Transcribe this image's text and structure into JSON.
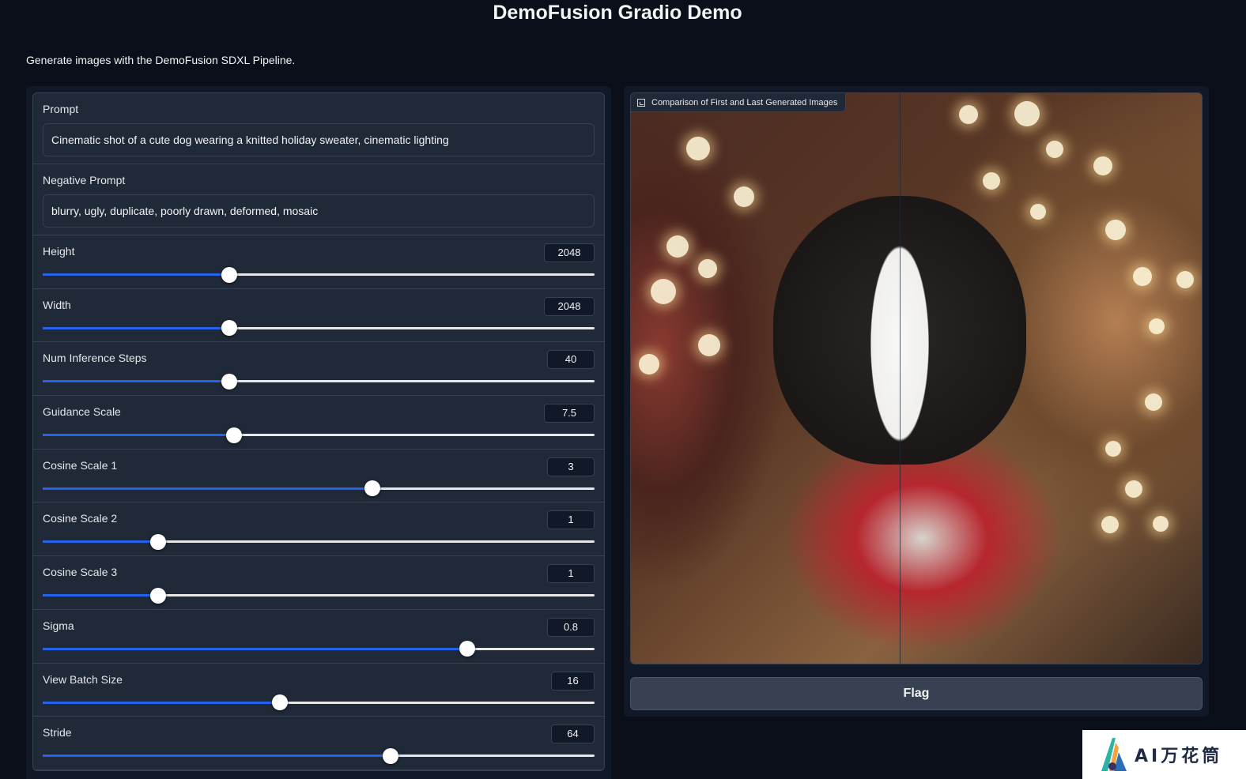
{
  "header": {
    "title": "DemoFusion Gradio Demo",
    "subtitle": "Generate images with the DemoFusion SDXL Pipeline."
  },
  "inputs": {
    "prompt": {
      "label": "Prompt",
      "value": "Cinematic shot of a cute dog wearing a knitted holiday sweater, cinematic lighting"
    },
    "negative_prompt": {
      "label": "Negative Prompt",
      "value": "blurry, ugly, duplicate, poorly drawn, deformed, mosaic"
    }
  },
  "sliders": [
    {
      "label": "Height",
      "value": "2048",
      "fraction": 0.338
    },
    {
      "label": "Width",
      "value": "2048",
      "fraction": 0.338
    },
    {
      "label": "Num Inference Steps",
      "value": "40",
      "fraction": 0.338
    },
    {
      "label": "Guidance Scale",
      "value": "7.5",
      "fraction": 0.346
    },
    {
      "label": "Cosine Scale 1",
      "value": "3",
      "fraction": 0.597
    },
    {
      "label": "Cosine Scale 2",
      "value": "1",
      "fraction": 0.209
    },
    {
      "label": "Cosine Scale 3",
      "value": "1",
      "fraction": 0.209
    },
    {
      "label": "Sigma",
      "value": "0.8",
      "fraction": 0.77
    },
    {
      "label": "View Batch Size",
      "value": "16",
      "fraction": 0.43
    },
    {
      "label": "Stride",
      "value": "64",
      "fraction": 0.63
    }
  ],
  "output": {
    "image_label": "Comparison of First and Last Generated Images",
    "flag_label": "Flag"
  },
  "watermark": {
    "text": "AI万花筒"
  },
  "colors": {
    "accent": "#2563eb",
    "background": "#0b0f19",
    "panel": "#1f2937"
  }
}
